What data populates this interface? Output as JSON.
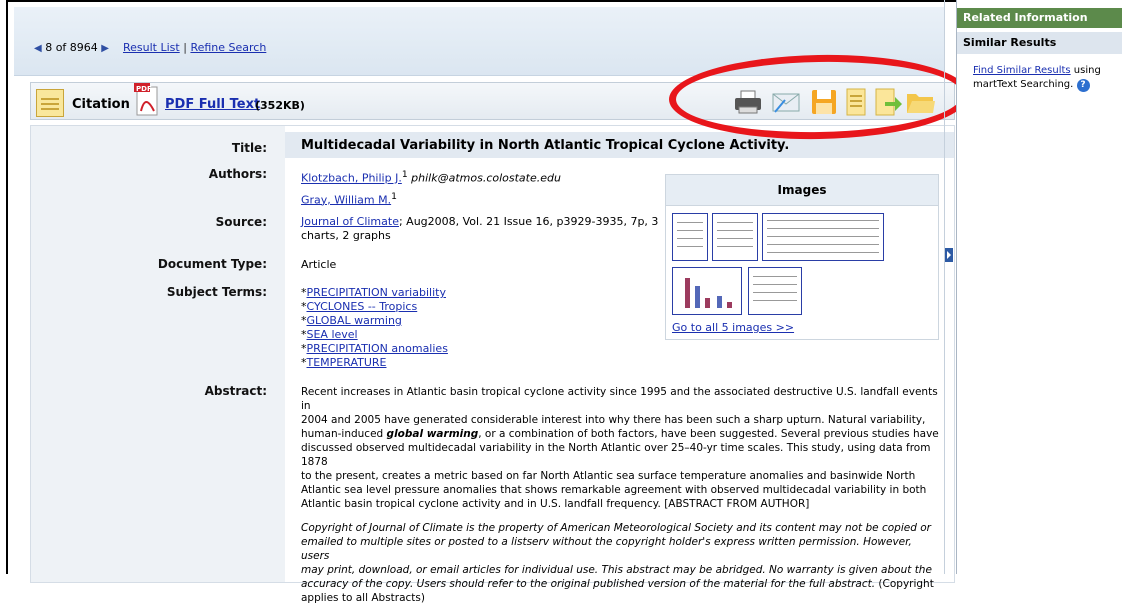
{
  "nav": {
    "position": "8 of 8964",
    "result_list": "Result List",
    "separator": "|",
    "refine_search": "Refine Search"
  },
  "toolbar": {
    "citation": "Citation",
    "pdf_link": "PDF Full Text",
    "pdf_size": "(352KB)",
    "tool_icons": [
      "print-icon",
      "email-icon",
      "save-icon",
      "cite-icon",
      "export-icon",
      "add-to-folder-icon"
    ]
  },
  "record": {
    "title_label": "Title:",
    "title": "Multidecadal Variability in North Atlantic Tropical Cyclone Activity.",
    "authors_label": "Authors:",
    "author1": "Klotzbach, Philip J.",
    "author1_sup": "1",
    "author1_email": "philk@atmos.colostate.edu",
    "author2": "Gray, William M.",
    "author2_sup": "1",
    "source_label": "Source:",
    "source_journal": "Journal of Climate",
    "source_rest": "; Aug2008, Vol. 21 Issue 16, p3929-3935, 7p, 3",
    "source_rest2": "charts, 2 graphs",
    "doctype_label": "Document Type:",
    "doctype": "Article",
    "subjects_label": "Subject Terms:",
    "subjects": [
      "PRECIPITATION variability",
      "CYCLONES -- Tropics",
      "GLOBAL warming",
      "SEA level",
      "PRECIPITATION anomalies",
      "TEMPERATURE"
    ],
    "subject_prefix": "*",
    "abstract_label": "Abstract:",
    "abstract_lines": [
      "Recent increases in Atlantic basin tropical cyclone activity since 1995 and the associated destructive U.S. landfall events in",
      "2004 and 2005 have generated considerable interest into why there has been such a sharp upturn. Natural variability,"
    ],
    "abstract_l3a": "human-induced ",
    "abstract_l3b": "global warming",
    "abstract_l3c": ", or a combination of both factors, have been suggested. Several previous studies have",
    "abstract_rest": [
      "discussed observed multidecadal variability in the North Atlantic over 25–40-yr time scales. This study, using data from 1878",
      "to the present, creates a metric based on far North Atlantic sea surface temperature anomalies and basinwide North",
      "Atlantic sea level pressure anomalies that shows remarkable agreement with observed multidecadal variability in both",
      "Atlantic basin tropical cyclone activity and in U.S. landfall frequency. [ABSTRACT FROM AUTHOR]"
    ],
    "copyright_lines": [
      "Copyright of Journal of Climate is the property of American Meteorological Society and its content may not be copied or",
      "emailed to multiple sites or posted to a listserv without the copyright holder's express written permission. However, users",
      "may print, download, or email articles for individual use. This abstract may be abridged. No warranty is given about the",
      "accuracy of the copy. Users should refer to the original published version of the material for the full abstract."
    ],
    "copyright_tail": " (Copyright",
    "copyright_last": "applies to all Abstracts)"
  },
  "images_panel": {
    "header": "Images",
    "goto": "Go to all 5 images >>"
  },
  "sidebar": {
    "related": "Related Information",
    "similar": "Similar Results",
    "find_similar": "Find Similar Results",
    "using": " using",
    "smarttext": "martText Searching.",
    "help": "?"
  },
  "annotation_color": "#e8161b"
}
